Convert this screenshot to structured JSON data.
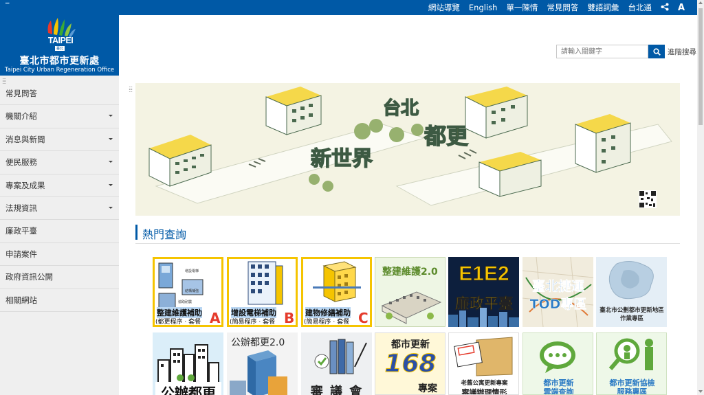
{
  "topbar": {
    "tiny_label": "═",
    "links": [
      "網站導覽",
      "English",
      "單一陳情",
      "常見問答",
      "雙語詞彙",
      "台北通"
    ],
    "font_size_label": "A"
  },
  "brand": {
    "logo_text": "TAIPEI",
    "logo_tag": "臺北",
    "name_cn": "臺北市都市更新處",
    "name_en": "Taipei City Urban Regeneration Office"
  },
  "menu": {
    "items": [
      {
        "label": "常見問答",
        "has_submenu": false
      },
      {
        "label": "機關介紹",
        "has_submenu": true
      },
      {
        "label": "消息與新聞",
        "has_submenu": true
      },
      {
        "label": "便民服務",
        "has_submenu": true
      },
      {
        "label": "專案及成果",
        "has_submenu": true
      },
      {
        "label": "法規資訊",
        "has_submenu": true
      },
      {
        "label": "廉政平臺",
        "has_submenu": false
      },
      {
        "label": "申請案件",
        "has_submenu": false
      },
      {
        "label": "政府資訊公開",
        "has_submenu": false
      },
      {
        "label": "相關網站",
        "has_submenu": false
      }
    ]
  },
  "search": {
    "placeholder": "請輸入關鍵字",
    "advanced_label": "進階搜尋"
  },
  "banner": {
    "title_top": "台北",
    "title_mid": "都更",
    "title_bottom": "新世界"
  },
  "section": {
    "title": "熱門查詢"
  },
  "tiles": [
    {
      "title": "整建維護補助",
      "subtitle": "(都更程序 · 套餐",
      "badge": "A",
      "labels": [
        "增設電梯",
        "結構補強",
        "協助耐震"
      ]
    },
    {
      "title": "增設電梯補助",
      "subtitle": "(簡易程序 · 套餐",
      "badge": "B"
    },
    {
      "title": "建物修繕補助",
      "subtitle": "(簡易程序 · 套餐",
      "badge": "C"
    },
    {
      "title": "整建維護2.0"
    },
    {
      "title": "E1E2",
      "subtitle": "廉政平臺"
    },
    {
      "title": "臺北捷運",
      "subtitle": "TOD專區"
    },
    {
      "title": "臺北市公劃都市更新地區作業專區"
    },
    {
      "title": "公辦都更"
    },
    {
      "title": "公辦都更2.0"
    },
    {
      "title": "審 議 會"
    },
    {
      "title": "都市更新",
      "subtitle": "168",
      "extra": "專案"
    },
    {
      "title": "老舊公寓更新專案",
      "subtitle": "審議辦理情形"
    },
    {
      "title": "都市更新",
      "subtitle": "雲端查詢"
    },
    {
      "title": "都市更新協檢",
      "subtitle": "服務專區"
    }
  ],
  "colors": {
    "brand_blue": "#0059a6",
    "tile_border_yellow": "#f5c400",
    "badge_red": "#e53b2c"
  }
}
